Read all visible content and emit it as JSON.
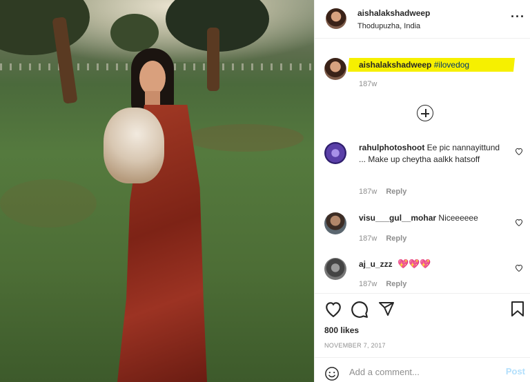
{
  "header": {
    "username": "aishalakshadweep",
    "location": "Thodupuzha, India",
    "more_icon": "more-icon"
  },
  "caption": {
    "username": "aishalakshadweep",
    "hashtag": "#ilovedog",
    "time": "187w",
    "highlight_color": "#f6f000"
  },
  "comments": [
    {
      "username": "rahulphotoshoot",
      "text": "Ee pic nannayittund ... Make up cheytha aalkk hatsoff",
      "time": "187w",
      "reply": "Reply"
    },
    {
      "username": "visu___gul__mohar",
      "text": "Niceeeeee",
      "time": "187w",
      "reply": "Reply"
    },
    {
      "username": "aj_u_zzz",
      "text": "💖💖💖",
      "time": "187w",
      "reply": "Reply"
    }
  ],
  "post": {
    "likes": "800 likes",
    "date": "NOVEMBER 7, 2017",
    "add_comment_placeholder": "Add a comment...",
    "post_label": "Post"
  },
  "colors": {
    "link": "#00376b",
    "muted": "#8e8e8e",
    "post_button": "#b2dffc",
    "heart": "#e0242a"
  }
}
